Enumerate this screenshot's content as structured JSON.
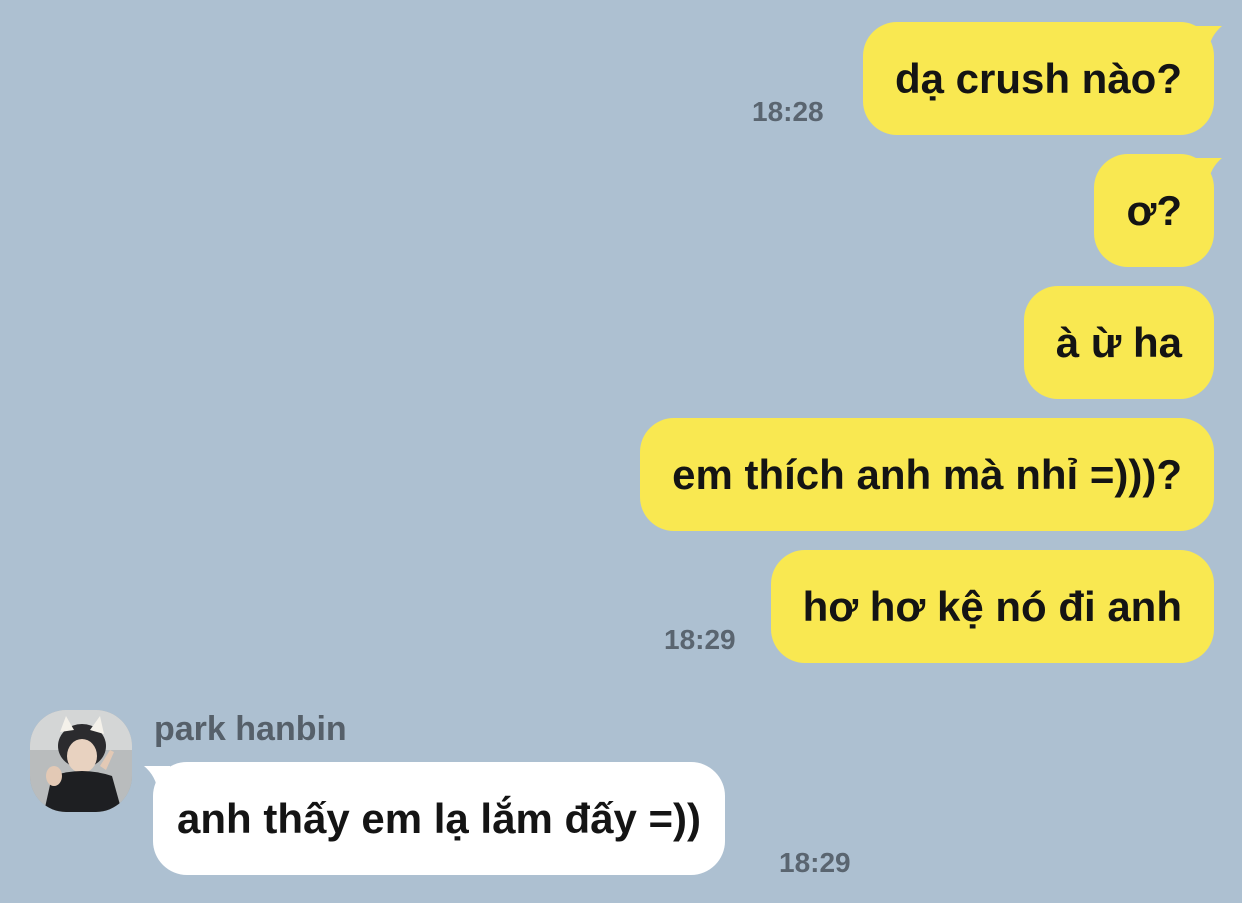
{
  "conversation": {
    "contact_name": "park hanbin",
    "messages": [
      {
        "direction": "sent",
        "text": "dạ crush nào?"
      },
      {
        "direction": "sent",
        "text": "ơ?"
      },
      {
        "direction": "sent",
        "text": "à ừ ha"
      },
      {
        "direction": "sent",
        "text": "em thích anh mà nhỉ =)))?"
      },
      {
        "direction": "sent",
        "text": "hơ hơ kệ nó đi anh"
      },
      {
        "direction": "received",
        "text": "anh thấy em lạ lắm đấy =))"
      }
    ],
    "timestamps": [
      "18:28",
      "18:29",
      "18:29"
    ]
  },
  "colors": {
    "background": "#adc0d1",
    "sent_bubble": "#f9e851",
    "received_bubble": "#ffffff",
    "timestamp": "#5a6570",
    "sender_name": "#56606a"
  }
}
